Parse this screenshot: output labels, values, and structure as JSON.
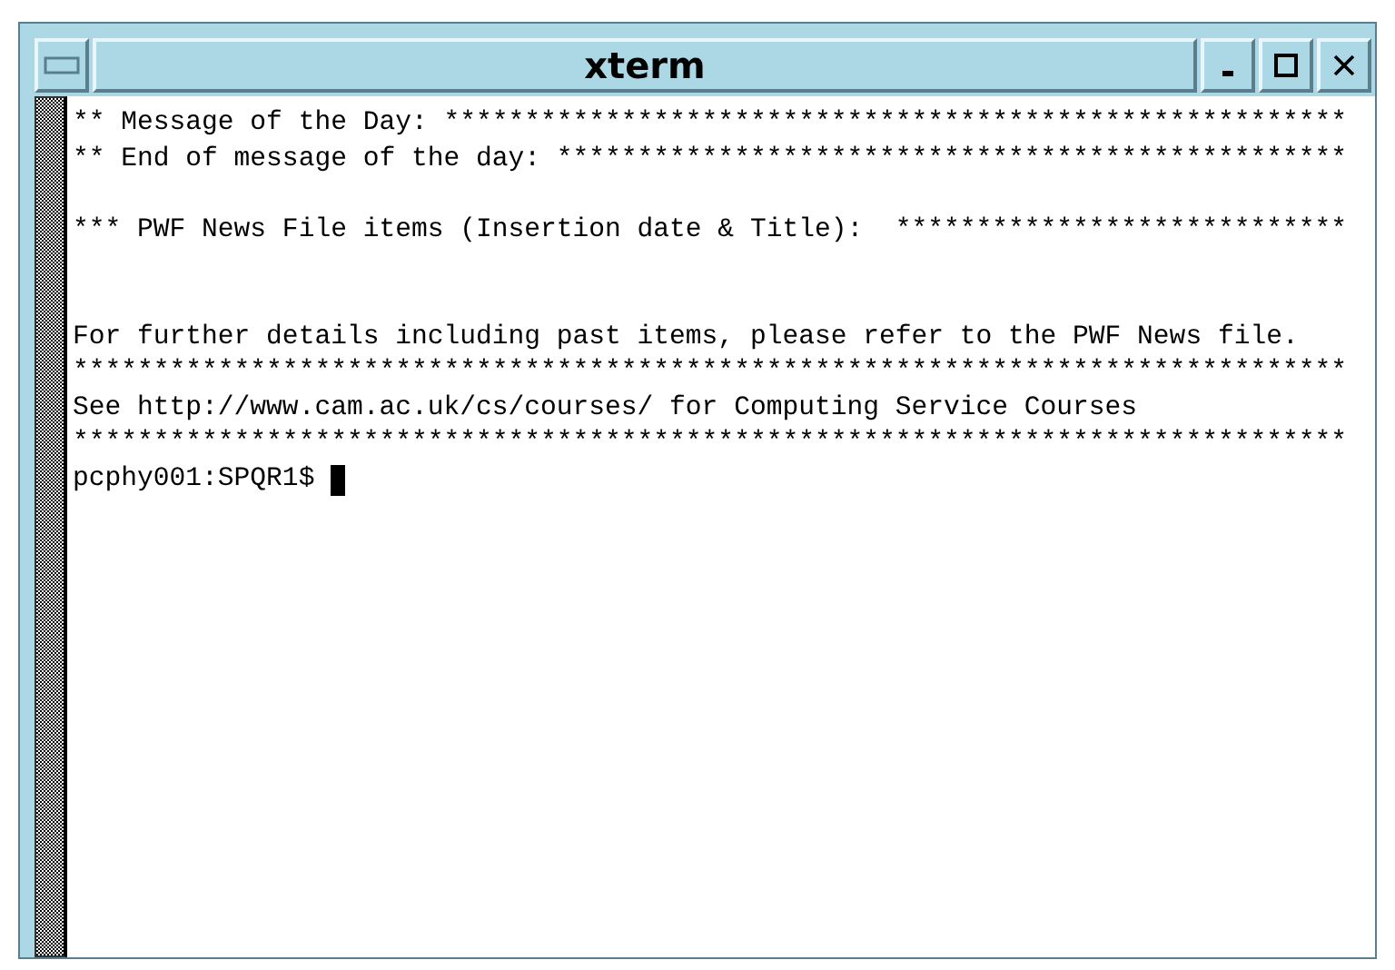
{
  "window": {
    "title": "xterm"
  },
  "terminal": {
    "lines": [
      {
        "kind": "text",
        "text": "** Message of the Day: ********************************************************"
      },
      {
        "kind": "text",
        "text": "** End of message of the day: *************************************************"
      },
      {
        "kind": "blank"
      },
      {
        "kind": "text",
        "text": "*** PWF News File items (Insertion date & Title):  ****************************"
      },
      {
        "kind": "blank"
      },
      {
        "kind": "blank"
      },
      {
        "kind": "text",
        "text": "For further details including past items, please refer to the PWF News file."
      },
      {
        "kind": "text",
        "text": "*******************************************************************************"
      },
      {
        "kind": "text",
        "text": "See http://www.cam.ac.uk/cs/courses/ for Computing Service Courses"
      },
      {
        "kind": "text",
        "text": "*******************************************************************************"
      },
      {
        "kind": "prompt",
        "text": "pcphy001:SPQR1$",
        "cursor": true
      }
    ]
  }
}
